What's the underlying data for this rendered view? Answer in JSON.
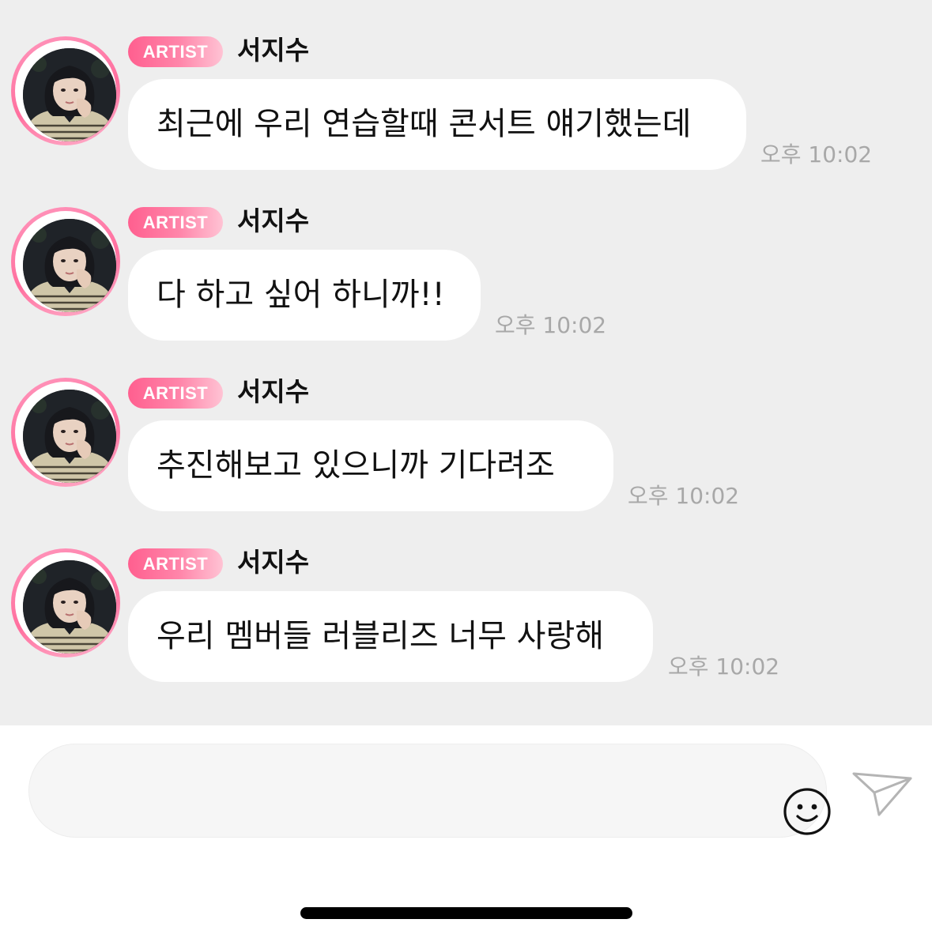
{
  "chat": {
    "messages": [
      {
        "badge": "ARTIST",
        "sender": "서지수",
        "text": "최근에 우리 연습할때 콘서트 얘기했는데",
        "time": "오후 10:02"
      },
      {
        "badge": "ARTIST",
        "sender": "서지수",
        "text": "다 하고 싶어 하니까!!",
        "time": "오후 10:02"
      },
      {
        "badge": "ARTIST",
        "sender": "서지수",
        "text": "추진해보고 있으니까 기다려조",
        "time": "오후 10:02"
      },
      {
        "badge": "ARTIST",
        "sender": "서지수",
        "text": "우리 멤버들 러블리즈 너무 사랑해",
        "time": "오후 10:02"
      }
    ]
  },
  "composer": {
    "placeholder": "",
    "emoji_icon": "smiley-face-icon",
    "send_icon": "paper-plane-icon"
  },
  "colors": {
    "chat_background": "#eeeeee",
    "badge_gradient_start": "#ff5f8f",
    "badge_gradient_end": "#ffc3d4",
    "avatar_ring": "#ff6f9e",
    "timestamp": "#a8a8a8",
    "bubble": "#ffffff"
  }
}
